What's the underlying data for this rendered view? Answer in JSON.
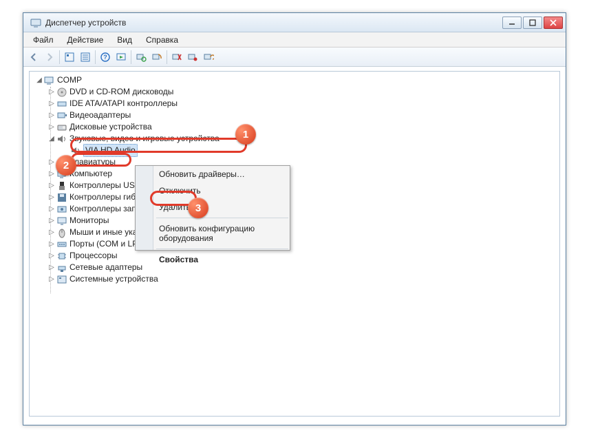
{
  "window": {
    "title": "Диспетчер устройств"
  },
  "menubar": [
    "Файл",
    "Действие",
    "Вид",
    "Справка"
  ],
  "tree": {
    "root": "COMP",
    "items": [
      "DVD и CD-ROM дисководы",
      "IDE ATA/ATAPI контроллеры",
      "Видеоадаптеры",
      "Дисковые устройства",
      "Звуковые, видео и игровые устройства",
      "VIA HD Audio",
      "Клавиатуры",
      "Компьютер",
      "Контроллеры USB",
      "Контроллеры гибких дисков",
      "Контроллеры запоминающих устройств",
      "Мониторы",
      "Мыши и иные указывающие устройства",
      "Порты (COM и LPT)",
      "Процессоры",
      "Сетевые адаптеры",
      "Системные устройства"
    ]
  },
  "context_menu": {
    "update": "Обновить драйверы…",
    "disable": "Отключить",
    "delete": "Удалить",
    "rescan": "Обновить конфигурацию оборудования",
    "props": "Свойства"
  },
  "callouts": {
    "n1": "1",
    "n2": "2",
    "n3": "3"
  }
}
